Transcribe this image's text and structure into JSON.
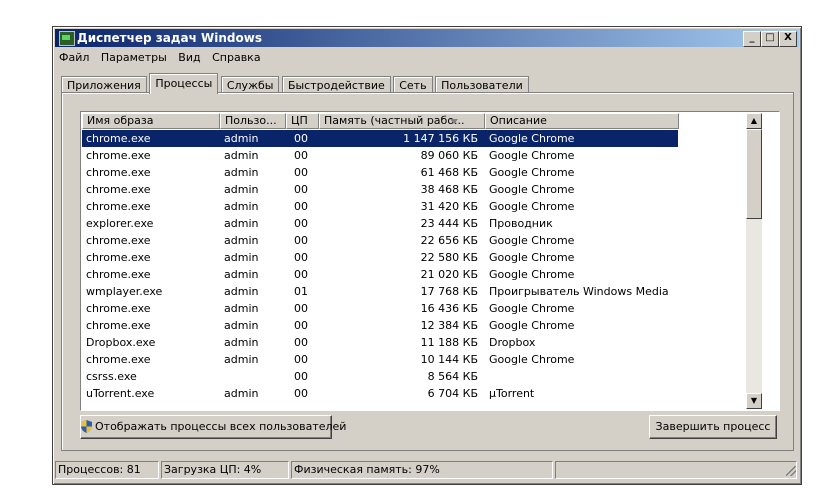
{
  "window": {
    "title": "Диспетчер задач Windows",
    "minimize": "_",
    "restore": "□",
    "close": "X"
  },
  "menu": [
    "Файл",
    "Параметры",
    "Вид",
    "Справка"
  ],
  "tabs": [
    "Приложения",
    "Процессы",
    "Службы",
    "Быстродействие",
    "Сеть",
    "Пользователи"
  ],
  "active_tab": 1,
  "columns": [
    "Имя образа",
    "Пользо...",
    "ЦП",
    "Память (частный рабо...",
    "Описание"
  ],
  "processes": [
    {
      "name": "chrome.exe",
      "user": "admin",
      "cpu": "00",
      "mem": "1 147 156 КБ",
      "desc": "Google Chrome"
    },
    {
      "name": "chrome.exe",
      "user": "admin",
      "cpu": "00",
      "mem": "89 060 КБ",
      "desc": "Google Chrome"
    },
    {
      "name": "chrome.exe",
      "user": "admin",
      "cpu": "00",
      "mem": "61 468 КБ",
      "desc": "Google Chrome"
    },
    {
      "name": "chrome.exe",
      "user": "admin",
      "cpu": "00",
      "mem": "38 468 КБ",
      "desc": "Google Chrome"
    },
    {
      "name": "chrome.exe",
      "user": "admin",
      "cpu": "00",
      "mem": "31 420 КБ",
      "desc": "Google Chrome"
    },
    {
      "name": "explorer.exe",
      "user": "admin",
      "cpu": "00",
      "mem": "23 444 КБ",
      "desc": "Проводник"
    },
    {
      "name": "chrome.exe",
      "user": "admin",
      "cpu": "00",
      "mem": "22 656 КБ",
      "desc": "Google Chrome"
    },
    {
      "name": "chrome.exe",
      "user": "admin",
      "cpu": "00",
      "mem": "22 580 КБ",
      "desc": "Google Chrome"
    },
    {
      "name": "chrome.exe",
      "user": "admin",
      "cpu": "00",
      "mem": "21 020 КБ",
      "desc": "Google Chrome"
    },
    {
      "name": "wmplayer.exe",
      "user": "admin",
      "cpu": "01",
      "mem": "17 768 КБ",
      "desc": "Проигрыватель Windows Media"
    },
    {
      "name": "chrome.exe",
      "user": "admin",
      "cpu": "00",
      "mem": "16 436 КБ",
      "desc": "Google Chrome"
    },
    {
      "name": "chrome.exe",
      "user": "admin",
      "cpu": "00",
      "mem": "12 384 КБ",
      "desc": "Google Chrome"
    },
    {
      "name": "Dropbox.exe",
      "user": "admin",
      "cpu": "00",
      "mem": "11 188 КБ",
      "desc": "Dropbox"
    },
    {
      "name": "chrome.exe",
      "user": "admin",
      "cpu": "00",
      "mem": "10 144 КБ",
      "desc": "Google Chrome"
    },
    {
      "name": "csrss.exe",
      "user": "",
      "cpu": "00",
      "mem": "8 564 КБ",
      "desc": ""
    },
    {
      "name": "uTorrent.exe",
      "user": "admin",
      "cpu": "00",
      "mem": "6 704 КБ",
      "desc": "µTorrent"
    }
  ],
  "selected_row": 0,
  "buttons": {
    "show_all": "Отображать процессы всех пользователей",
    "end_process": "Завершить процесс"
  },
  "status": {
    "processes": "Процессов: 81",
    "cpu": "Загрузка ЦП: 4%",
    "memory": "Физическая память: 97%"
  }
}
